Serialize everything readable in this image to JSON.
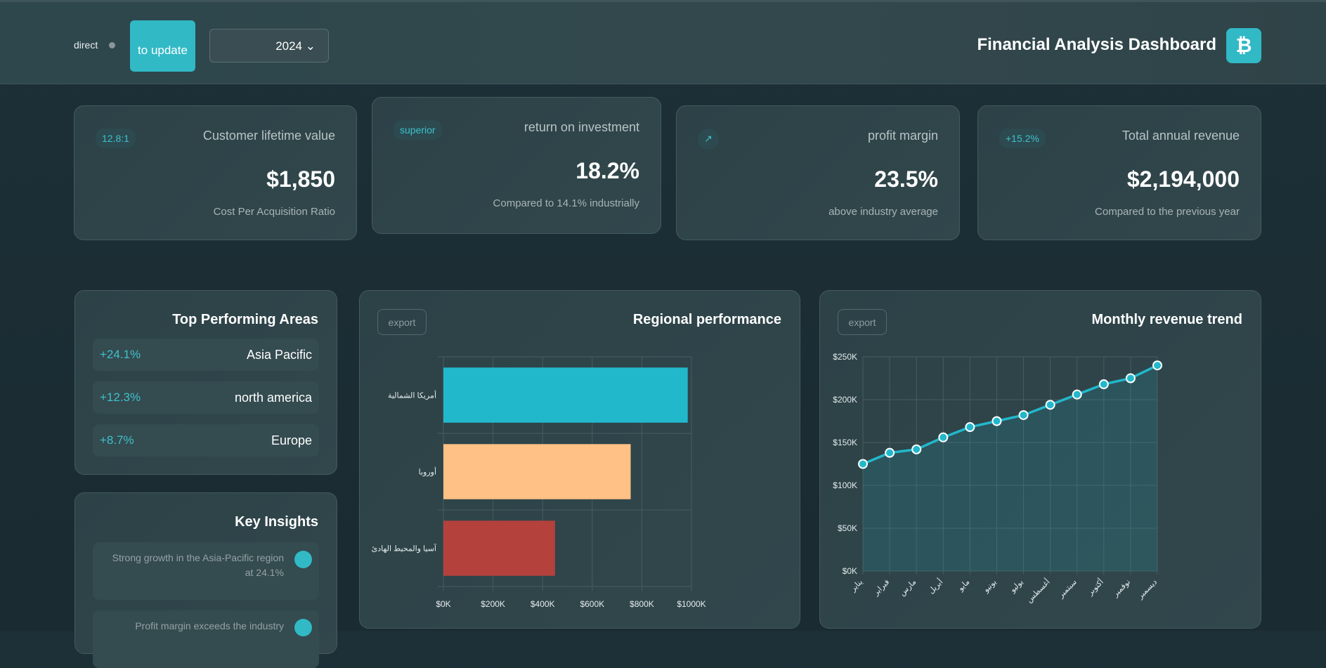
{
  "header": {
    "status": "direct",
    "update_label": "to update",
    "year": "2024",
    "title": "Financial Analysis Dashboard",
    "logo_symbol": "₿"
  },
  "kpis": [
    {
      "badge": "12.8:1",
      "label": "Customer lifetime value",
      "value": "$1,850",
      "sub": "Cost Per Acquisition Ratio"
    },
    {
      "badge": "superior",
      "label": "return on investment",
      "value": "18.2%",
      "sub": "Compared to 14.1% industrially"
    },
    {
      "badge": "↗",
      "label": "profit margin",
      "value": "23.5%",
      "sub": "above industry average"
    },
    {
      "badge": "+15.2%",
      "label": "Total annual revenue",
      "value": "$2,194,000",
      "sub": "Compared to the previous year"
    }
  ],
  "top_areas": {
    "title": "Top Performing Areas",
    "items": [
      {
        "pct": "+24.1%",
        "name": "Asia Pacific"
      },
      {
        "pct": "+12.3%",
        "name": "north america"
      },
      {
        "pct": "+8.7%",
        "name": "Europe"
      }
    ]
  },
  "insights": {
    "title": "Key Insights",
    "items": [
      {
        "text": "Strong growth in the Asia-Pacific region at 24.1%"
      },
      {
        "text": "Profit margin exceeds the industry"
      }
    ]
  },
  "export_label": "export",
  "chart_data": [
    {
      "type": "bar",
      "title": "Regional performance",
      "orientation": "horizontal",
      "categories": [
        "أمريكا الشمالية",
        "أوروبا",
        "آسيا والمحيط الهادئ"
      ],
      "values": [
        985,
        755,
        450
      ],
      "colors": [
        "#22b8cc",
        "#ffc185",
        "#b4413c"
      ],
      "xlim": [
        0,
        1000
      ],
      "xticks": [
        "$0K",
        "$200K",
        "$400K",
        "$600K",
        "$800K",
        "$1000K"
      ],
      "grid": true
    },
    {
      "type": "line",
      "title": "Monthly revenue trend",
      "categories": [
        "يناير",
        "فبراير",
        "مارس",
        "أبريل",
        "مايو",
        "يونيو",
        "يوليو",
        "أغسطس",
        "سبتمبر",
        "أكتوبر",
        "نوفمبر",
        "ديسمبر"
      ],
      "values": [
        125,
        138,
        142,
        156,
        168,
        175,
        182,
        194,
        206,
        218,
        225,
        240
      ],
      "ylim": [
        0,
        250
      ],
      "yticks": [
        "$0K",
        "$50K",
        "$100K",
        "$150K",
        "$200K",
        "$250K"
      ],
      "color": "#22b8cc",
      "fill": true,
      "grid": true
    }
  ]
}
